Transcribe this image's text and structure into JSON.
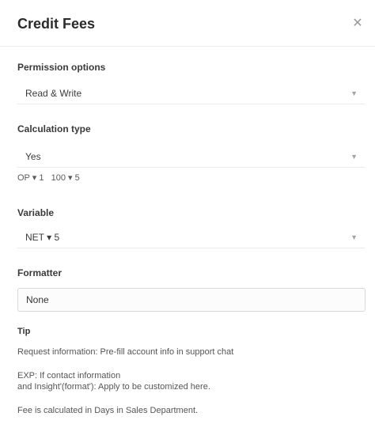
{
  "header": {
    "title": "Credit Fees",
    "close_icon": "close-icon"
  },
  "fields": {
    "field1": {
      "label": "Permission options",
      "value": "Read & Write"
    },
    "field2": {
      "label": "Calculation type",
      "value": "Yes",
      "sub": "OP ▾ 1   100 ▾ 5"
    },
    "field3": {
      "label": "Variable",
      "value": "NET ▾ 5"
    },
    "field4": {
      "label": "Formatter",
      "value": "None"
    }
  },
  "notes": {
    "heading": "Tip",
    "line1": "Request information: Pre-fill account info in support chat",
    "line2a": "EXP: If contact information",
    "line2b": "and Insight'(format'): Apply to be customized here.",
    "line3": "Fee is calculated in Days in Sales Department."
  }
}
